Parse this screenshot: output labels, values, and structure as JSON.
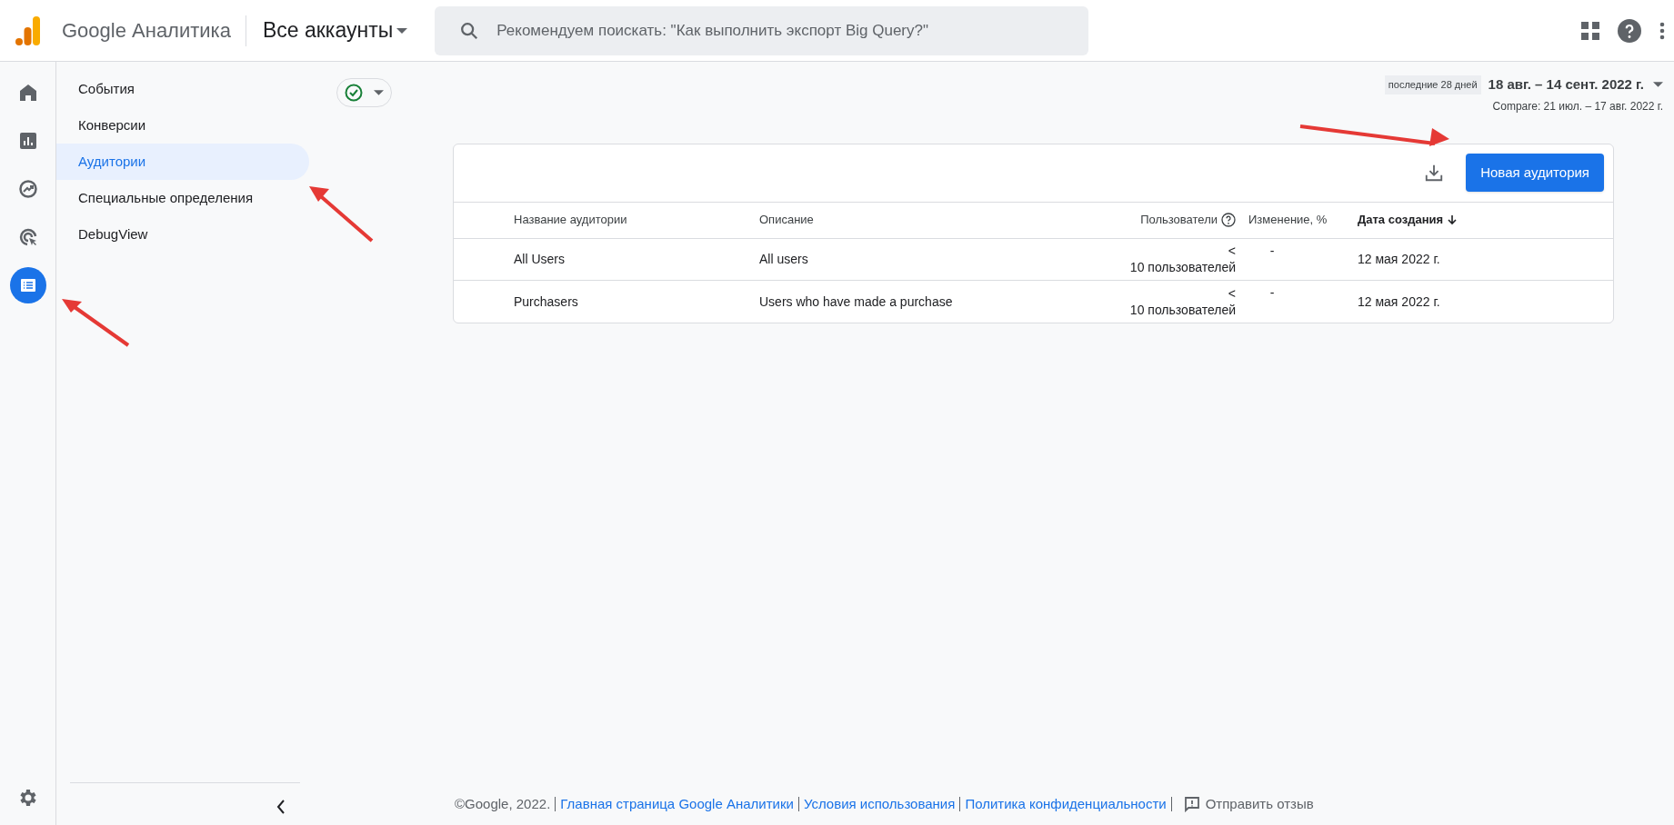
{
  "header": {
    "product": "Google Аналитика",
    "account": "Все аккаунты",
    "search": {
      "placeholder": "Рекомендуем поискать: \"Как выполнить экспорт Big Query?\""
    }
  },
  "rail": [
    {
      "kind": "home",
      "selected": false
    },
    {
      "kind": "reports",
      "selected": false
    },
    {
      "kind": "explore",
      "selected": false
    },
    {
      "kind": "advertising",
      "selected": false
    },
    {
      "kind": "configure",
      "selected": true
    }
  ],
  "nav": [
    {
      "label": "События",
      "selected": false
    },
    {
      "label": "Конверсии",
      "selected": false
    },
    {
      "label": "Аудитории",
      "selected": true
    },
    {
      "label": "Специальные определения",
      "selected": false
    },
    {
      "label": "DebugView",
      "selected": false
    }
  ],
  "date_range": {
    "preset": "последние 28 дней",
    "range": "18 авг. – 14 сент. 2022 г.",
    "compare": "Compare: 21 июл. – 17 авг. 2022 г."
  },
  "table": {
    "button": "Новая аудитория",
    "columns": [
      {
        "label": "Название аудитории",
        "help": false,
        "sorted": false
      },
      {
        "label": "Описание",
        "help": false,
        "sorted": false
      },
      {
        "label": "Пользователи",
        "help": true,
        "sorted": false
      },
      {
        "label": "Изменение, %",
        "help": false,
        "sorted": false
      },
      {
        "label": "Дата создания",
        "help": false,
        "sorted": true
      }
    ],
    "rows": [
      {
        "cells": [
          "All Users",
          "All users",
          "<\n10 пользователей",
          "-",
          "12 мая 2022 г."
        ]
      },
      {
        "cells": [
          "Purchasers",
          "Users who have made a purchase",
          "<\n10 пользователей",
          "-",
          "12 мая 2022 г."
        ]
      }
    ]
  },
  "footer": {
    "copyright": "©Google, 2022.",
    "links": [
      "Главная страница Google Аналитики",
      "Условия использования",
      "Политика конфиденциальности"
    ],
    "feedback": "Отправить отзыв"
  }
}
